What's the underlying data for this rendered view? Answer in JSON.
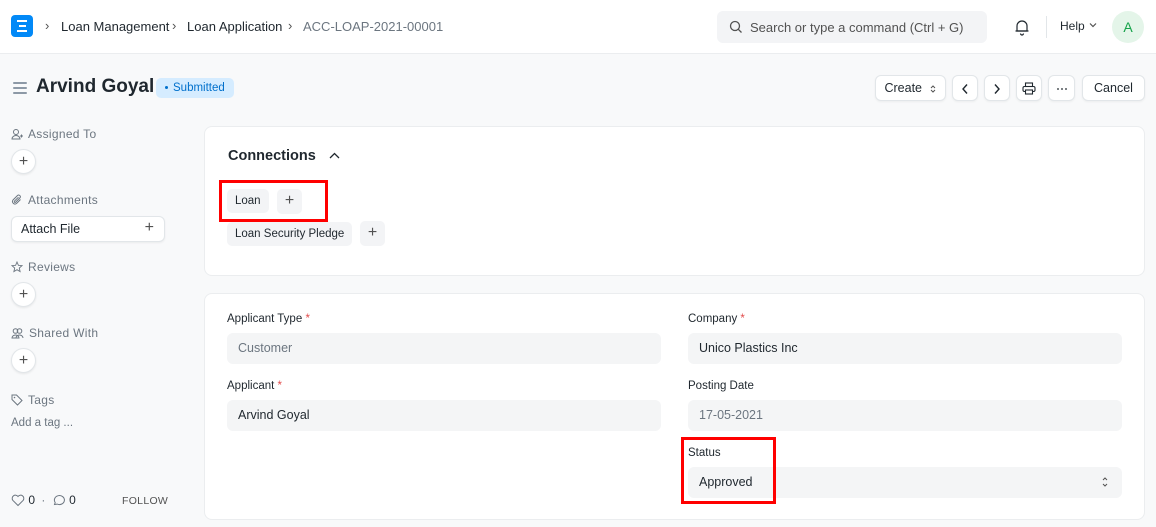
{
  "navbar": {
    "breadcrumbs": [
      "Loan Management",
      "Loan Application",
      "ACC-LOAP-2021-00001"
    ],
    "search_placeholder": "Search or type a command (Ctrl + G)",
    "help_label": "Help",
    "avatar_initial": "A",
    "brand_color": "#0289f7"
  },
  "page": {
    "title": "Arvind Goyal",
    "status_badge": "Submitted",
    "actions": {
      "create_label": "Create",
      "cancel_label": "Cancel"
    }
  },
  "sidebar": {
    "assigned_to": "Assigned To",
    "attachments": "Attachments",
    "attach_file": "Attach File",
    "reviews": "Reviews",
    "shared_with": "Shared With",
    "tags": "Tags",
    "add_tag": "Add a tag ...",
    "likes": "0",
    "comments": "0",
    "follow": "FOLLOW"
  },
  "connections": {
    "title": "Connections",
    "items": [
      {
        "label": "Loan"
      },
      {
        "label": "Loan Security Pledge"
      }
    ]
  },
  "form": {
    "applicant_type": {
      "label": "Applicant Type",
      "value": "Customer",
      "required": "*"
    },
    "applicant": {
      "label": "Applicant",
      "value": "Arvind Goyal",
      "required": "*"
    },
    "company": {
      "label": "Company",
      "value": "Unico Plastics Inc",
      "required": "*"
    },
    "posting_date": {
      "label": "Posting Date",
      "value": "17-05-2021"
    },
    "status": {
      "label": "Status",
      "value": "Approved"
    }
  }
}
